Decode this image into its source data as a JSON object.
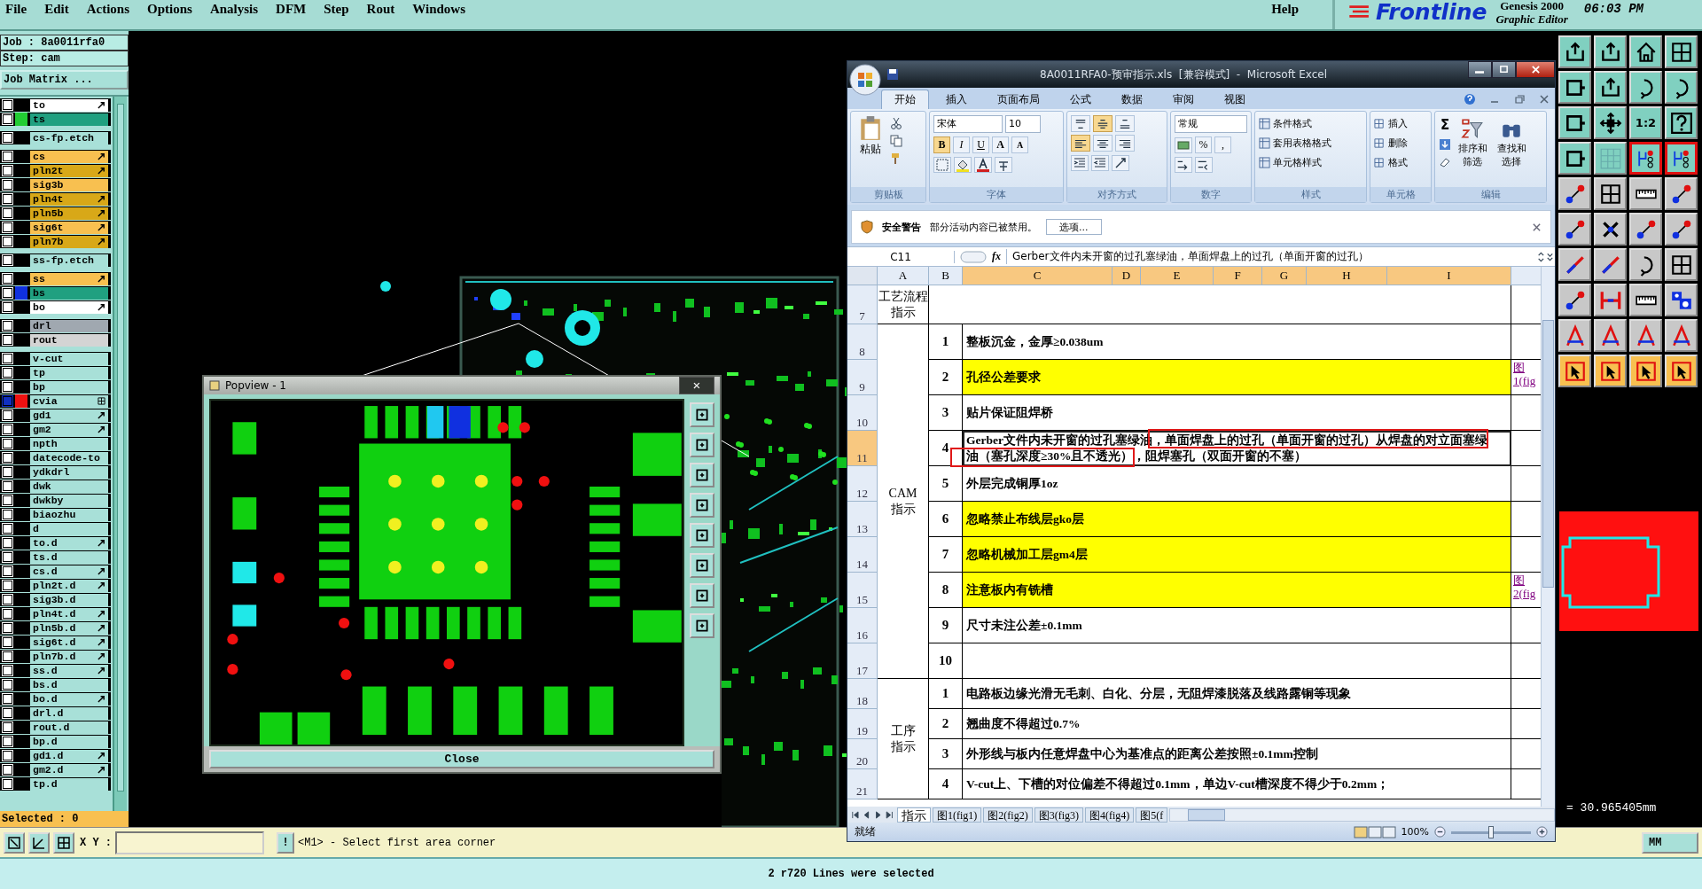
{
  "menu": {
    "items": [
      "File",
      "Edit",
      "Actions",
      "Options",
      "Analysis",
      "DFM",
      "Step",
      "Rout",
      "Windows"
    ],
    "help": "Help"
  },
  "brand": {
    "logo": "Frontline",
    "product": "Genesis 2000",
    "subtitle": "Graphic Editor",
    "clock": "06:03 PM"
  },
  "job_panel": {
    "job": "Job : 8a0011rfa0",
    "step": "Step: cam",
    "matrix_button": "Job Matrix ...",
    "selected_count": "Selected : 0",
    "groups": [
      [
        {
          "name": "to",
          "kind": "silk",
          "arrow": true,
          "grid": false,
          "selected": false
        },
        {
          "name": "ts",
          "kind": "mask",
          "color": "#22cc33",
          "arrow": false,
          "grid": false,
          "selected": false
        }
      ],
      [
        {
          "name": "cs-fp.etch",
          "kind": "doc",
          "arrow": false,
          "grid": false,
          "selected": false
        }
      ],
      [
        {
          "name": "cs",
          "kind": "signal",
          "arrow": true,
          "grid": false,
          "selected": false
        },
        {
          "name": "pln2t",
          "kind": "power",
          "arrow": true,
          "grid": false,
          "selected": false
        },
        {
          "name": "sig3b",
          "kind": "signal",
          "arrow": false,
          "grid": false,
          "selected": false
        },
        {
          "name": "pln4t",
          "kind": "power",
          "arrow": true,
          "grid": false,
          "selected": false
        },
        {
          "name": "pln5b",
          "kind": "power",
          "arrow": true,
          "grid": false,
          "selected": false
        },
        {
          "name": "sig6t",
          "kind": "signal",
          "arrow": true,
          "grid": false,
          "selected": false
        },
        {
          "name": "pln7b",
          "kind": "power",
          "arrow": true,
          "grid": false,
          "selected": false
        }
      ],
      [
        {
          "name": "ss-fp.etch",
          "kind": "doc",
          "arrow": false,
          "grid": false,
          "selected": false
        }
      ],
      [
        {
          "name": "ss",
          "kind": "signal",
          "arrow": true,
          "grid": false,
          "selected": false
        },
        {
          "name": "bs",
          "kind": "mask",
          "color": "#1030e0",
          "arrow": false,
          "grid": false,
          "selected": false
        },
        {
          "name": "bo",
          "kind": "silk",
          "arrow": true,
          "grid": false,
          "selected": false
        }
      ],
      [
        {
          "name": "drl",
          "kind": "drill",
          "arrow": false,
          "grid": false,
          "selected": false
        },
        {
          "name": "rout",
          "kind": "rout",
          "arrow": false,
          "grid": false,
          "selected": false
        }
      ],
      [
        {
          "name": "v-cut",
          "kind": "doc",
          "arrow": false,
          "grid": false,
          "selected": false
        },
        {
          "name": "tp",
          "kind": "doc",
          "arrow": false,
          "grid": false,
          "selected": false
        },
        {
          "name": "bp",
          "kind": "doc",
          "arrow": false,
          "grid": false,
          "selected": false
        },
        {
          "name": "cvia",
          "kind": "doc",
          "color": "#ee1111",
          "arrow": false,
          "grid": true,
          "selected": true
        },
        {
          "name": "gd1",
          "kind": "doc",
          "arrow": true,
          "grid": false,
          "selected": false
        },
        {
          "name": "gm2",
          "kind": "doc",
          "arrow": true,
          "grid": false,
          "selected": false
        },
        {
          "name": "npth",
          "kind": "doc",
          "arrow": false,
          "grid": false,
          "selected": false
        },
        {
          "name": "datecode-to",
          "kind": "doc",
          "arrow": false,
          "grid": false,
          "selected": false
        },
        {
          "name": "ydkdrl",
          "kind": "doc",
          "arrow": false,
          "grid": false,
          "selected": false
        },
        {
          "name": "dwk",
          "kind": "doc",
          "arrow": false,
          "grid": false,
          "selected": false
        },
        {
          "name": "dwkby",
          "kind": "doc",
          "arrow": false,
          "grid": false,
          "selected": false
        },
        {
          "name": "biaozhu",
          "kind": "doc",
          "arrow": false,
          "grid": false,
          "selected": false
        },
        {
          "name": "d",
          "kind": "doc",
          "arrow": false,
          "grid": false,
          "selected": false
        },
        {
          "name": "to.d",
          "kind": "doc",
          "arrow": true,
          "grid": false,
          "selected": false
        },
        {
          "name": "ts.d",
          "kind": "doc",
          "arrow": false,
          "grid": false,
          "selected": false
        },
        {
          "name": "cs.d",
          "kind": "doc",
          "arrow": true,
          "grid": false,
          "selected": false
        },
        {
          "name": "pln2t.d",
          "kind": "doc",
          "arrow": true,
          "grid": false,
          "selected": false
        },
        {
          "name": "sig3b.d",
          "kind": "doc",
          "arrow": false,
          "grid": false,
          "selected": false
        },
        {
          "name": "pln4t.d",
          "kind": "doc",
          "arrow": true,
          "grid": false,
          "selected": false
        },
        {
          "name": "pln5b.d",
          "kind": "doc",
          "arrow": true,
          "grid": false,
          "selected": false
        },
        {
          "name": "sig6t.d",
          "kind": "doc",
          "arrow": true,
          "grid": false,
          "selected": false
        },
        {
          "name": "pln7b.d",
          "kind": "doc",
          "arrow": true,
          "grid": false,
          "selected": false
        },
        {
          "name": "ss.d",
          "kind": "doc",
          "arrow": true,
          "grid": false,
          "selected": false
        },
        {
          "name": "bs.d",
          "kind": "doc",
          "arrow": false,
          "grid": false,
          "selected": false
        },
        {
          "name": "bo.d",
          "kind": "doc",
          "arrow": true,
          "grid": false,
          "selected": false
        },
        {
          "name": "drl.d",
          "kind": "doc",
          "arrow": false,
          "grid": false,
          "selected": false
        },
        {
          "name": "rout.d",
          "kind": "doc",
          "arrow": false,
          "grid": false,
          "selected": false
        },
        {
          "name": "bp.d",
          "kind": "doc",
          "arrow": false,
          "grid": false,
          "selected": false
        },
        {
          "name": "gd1.d",
          "kind": "doc",
          "arrow": true,
          "grid": false,
          "selected": false
        },
        {
          "name": "gm2.d",
          "kind": "doc",
          "arrow": true,
          "grid": false,
          "selected": false
        },
        {
          "name": "tp.d",
          "kind": "doc",
          "arrow": false,
          "grid": false,
          "selected": false
        }
      ]
    ]
  },
  "popview": {
    "title": "Popview - 1",
    "close_glyph": "×",
    "close_button": "Close"
  },
  "toolbar": [
    {
      "kind": "teal",
      "buttons": [
        {
          "selected": false
        },
        {
          "selected": false
        },
        {
          "selected": false
        },
        {
          "selected": false
        }
      ]
    },
    {
      "kind": "teal",
      "buttons": [
        {
          "selected": false
        },
        {
          "selected": false
        },
        {
          "selected": false
        },
        {
          "selected": false
        }
      ]
    },
    {
      "kind": "teal",
      "buttons": [
        {
          "selected": false
        },
        {
          "selected": false
        },
        {
          "label": "1:2",
          "selected": false
        },
        {
          "selected": false
        }
      ]
    },
    {
      "kind": "teal",
      "buttons": [
        {
          "selected": false
        },
        {
          "selected": false
        },
        {
          "selected": true
        },
        {
          "selected": true
        }
      ]
    },
    {
      "kind": "gray",
      "buttons": [
        {
          "selected": false
        },
        {
          "selected": false
        },
        {
          "selected": false
        },
        {
          "selected": false
        }
      ]
    },
    {
      "kind": "gray",
      "buttons": [
        {
          "selected": false
        },
        {
          "selected": false
        },
        {
          "selected": false
        },
        {
          "selected": false
        }
      ]
    },
    {
      "kind": "gray",
      "buttons": [
        {
          "selected": false
        },
        {
          "selected": false
        },
        {
          "selected": false
        },
        {
          "selected": false
        }
      ]
    },
    {
      "kind": "gray",
      "buttons": [
        {
          "selected": false
        },
        {
          "selected": false
        },
        {
          "selected": false
        },
        {
          "selected": false
        }
      ]
    },
    {
      "kind": "gray",
      "buttons": [
        {
          "selected": false
        },
        {
          "selected": false
        },
        {
          "selected": false
        },
        {
          "selected": false
        }
      ]
    },
    {
      "kind": "orange",
      "buttons": [
        {
          "selected": false
        },
        {
          "selected": false
        },
        {
          "selected": false
        },
        {
          "selected": false
        }
      ]
    }
  ],
  "measurement": "= 30.965405mm",
  "excel": {
    "title": "8A0011RFA0-预审指示.xls  [兼容模式]  -  Microsoft Excel",
    "tabs": [
      {
        "label": "开始",
        "selected": true
      },
      {
        "label": "插入",
        "selected": false
      },
      {
        "label": "页面布局",
        "selected": false
      },
      {
        "label": "公式",
        "selected": false
      },
      {
        "label": "数据",
        "selected": false
      },
      {
        "label": "审阅",
        "selected": false
      },
      {
        "label": "视图",
        "selected": false
      }
    ],
    "clipboard": {
      "paste": "粘贴",
      "group": "剪贴板"
    },
    "font": {
      "name": "宋体",
      "size": "10",
      "styles": [
        {
          "label": "B",
          "selected": true
        },
        {
          "label": "I",
          "selected": false
        },
        {
          "label": "U",
          "selected": false
        }
      ],
      "sizers": [
        "A",
        "A"
      ],
      "group": "字体"
    },
    "alignment": {
      "buttons": [
        {
          "selected": false
        },
        {
          "selected": true
        },
        {
          "selected": false
        },
        {
          "selected": true
        },
        {
          "selected": false
        },
        {
          "selected": false
        }
      ],
      "group": "对齐方式"
    },
    "number": {
      "format": "常规",
      "symbols": [
        "%",
        ","
      ],
      "group": "数字"
    },
    "styles": {
      "items": [
        "条件格式",
        "套用表格格式",
        "单元格样式"
      ],
      "group": "样式"
    },
    "cells": {
      "items": [
        "插入",
        "删除",
        "格式"
      ],
      "group": "单元格"
    },
    "editing": {
      "sum": "Σ",
      "items": [
        "排序和筛选",
        "查找和选择"
      ],
      "group": "编辑"
    },
    "security": {
      "title": "安全警告",
      "message": "部分活动内容已被禁用。",
      "button": "选项..."
    },
    "name_box": "C11",
    "function_label": "fx",
    "formula": "Gerber文件内未开窗的过孔塞绿油，单面焊盘上的过孔（单面开窗的过孔）",
    "columns": [
      {
        "label": "A",
        "selected": false
      },
      {
        "label": "B",
        "selected": false
      },
      {
        "label": "C",
        "selected": true
      },
      {
        "label": "D",
        "selected": true
      },
      {
        "label": "E",
        "selected": true
      },
      {
        "label": "F",
        "selected": true
      },
      {
        "label": "G",
        "selected": true
      },
      {
        "label": "H",
        "selected": true
      },
      {
        "label": "I",
        "selected": true
      }
    ],
    "sections": [
      {
        "label_lines": [
          "工艺流程",
          "指示"
        ],
        "rows": [
          {
            "row": "7",
            "selected": false
          }
        ]
      },
      {
        "label_lines": [
          "CAM",
          "指示"
        ],
        "rows": [
          {
            "row": "8",
            "no": "1",
            "text": "整板沉金，金厚≥0.038um",
            "selected": false,
            "highlight": false,
            "annotated": false
          },
          {
            "row": "9",
            "no": "2",
            "text": "孔径公差要求",
            "link": "图1(fig",
            "selected": false,
            "highlight": true,
            "annotated": false
          },
          {
            "row": "10",
            "no": "3",
            "text": "贴片保证阻焊桥",
            "selected": false,
            "highlight": false,
            "annotated": false
          },
          {
            "row": "11",
            "no": "4",
            "text": "Gerber文件内未开窗的过孔塞绿油，单面焊盘上的过孔（单面开窗的过孔）从焊盘的对立面塞绿油（塞孔深度≥30%且不透光），阻焊塞孔（双面开窗的不塞）",
            "selected": true,
            "highlight": false,
            "annotated": true
          },
          {
            "row": "12",
            "no": "5",
            "text": "外层完成铜厚1oz",
            "selected": false,
            "highlight": false,
            "annotated": false
          },
          {
            "row": "13",
            "no": "6",
            "text": "忽略禁止布线层gko层",
            "selected": false,
            "highlight": true,
            "annotated": false
          },
          {
            "row": "14",
            "no": "7",
            "text": "忽略机械加工层gm4层",
            "selected": false,
            "highlight": true,
            "annotated": false
          },
          {
            "row": "15",
            "no": "8",
            "text": "注意板内有铣槽",
            "link": "图2(fig",
            "selected": false,
            "highlight": true,
            "annotated": false
          },
          {
            "row": "16",
            "no": "9",
            "text": "尺寸未注公差±0.1mm",
            "selected": false,
            "highlight": false,
            "annotated": false
          },
          {
            "row": "17",
            "no": "10",
            "selected": false,
            "highlight": false,
            "annotated": false
          }
        ]
      },
      {
        "label_lines": [
          "工序",
          "指示"
        ],
        "rows": [
          {
            "row": "18",
            "no": "1",
            "text": "电路板边缘光滑无毛刺、白化、分层，无阻焊漆脱落及线路露铜等现象",
            "selected": false,
            "highlight": false,
            "annotated": false
          },
          {
            "row": "19",
            "no": "2",
            "text": "翘曲度不得超过0.7%",
            "selected": false,
            "highlight": false,
            "annotated": false
          },
          {
            "row": "20",
            "no": "3",
            "text": "外形线与板内任意焊盘中心为基准点的距离公差按照±0.1mm控制",
            "selected": false,
            "highlight": false,
            "annotated": false
          },
          {
            "row": "21",
            "no": "4",
            "text": "V-cut上、下槽的对位偏差不得超过0.1mm，单边V-cut槽深度不得少于0.2mm；",
            "selected": false,
            "highlight": false,
            "annotated": false
          }
        ]
      }
    ],
    "sheet_tabs": [
      {
        "label": "指示",
        "selected": true
      },
      {
        "label": "图1(fig1)",
        "selected": false
      },
      {
        "label": "图2(fig2)",
        "selected": false
      },
      {
        "label": "图3(fig3)",
        "selected": false
      },
      {
        "label": "图4(fig4)",
        "selected": false
      },
      {
        "label": "图5(f",
        "selected": false
      }
    ],
    "status": "就绪",
    "zoom": "100%",
    "zoom_slider": {
      "level": 0.5
    }
  },
  "command_bar": {
    "xy_label": "X Y :",
    "bang": "!",
    "prompt": "<M1> - Select first area corner",
    "units": "MM"
  },
  "status_line": "2 r720 Lines were selected"
}
